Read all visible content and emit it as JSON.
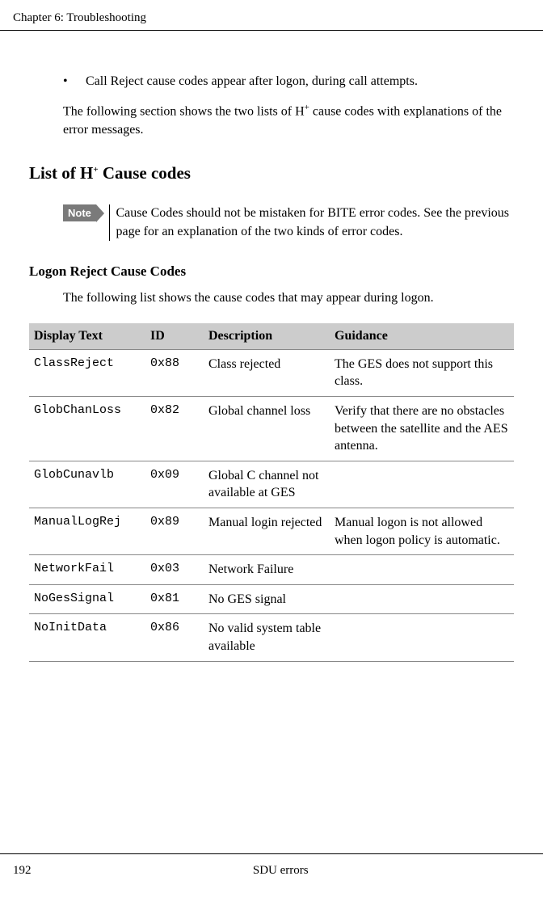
{
  "header": {
    "chapter": "Chapter 6:  Troubleshooting"
  },
  "bullet": {
    "dot": "•",
    "text": "Call Reject cause codes appear after logon, during call attempts."
  },
  "intro": {
    "line1": "The following section shows the two lists of H",
    "sup": "+",
    "line2": " cause codes with explanations of the error messages."
  },
  "section": {
    "title_a": "List of H",
    "title_sup": "+",
    "title_b": " Cause codes"
  },
  "note": {
    "tag": "Note",
    "text": "Cause Codes should not be mistaken for BITE error codes. See the previous page for an explanation of the two kinds of error codes."
  },
  "sub": {
    "heading": "Logon Reject Cause Codes",
    "para": "The following list shows the cause codes that may appear during logon."
  },
  "table": {
    "headers": {
      "display": "Display Text",
      "id": "ID",
      "desc": "Description",
      "guidance": "Guidance"
    },
    "rows": [
      {
        "display": "ClassReject",
        "id": "0x88",
        "desc": "Class rejected",
        "guidance": "The GES does not support this class."
      },
      {
        "display": "GlobChanLoss",
        "id": "0x82",
        "desc": "Global channel loss",
        "guidance": "Verify that there are no obstacles between the satellite and the AES antenna."
      },
      {
        "display": "GlobCunavlb",
        "id": "0x09",
        "desc": "Global C channel not available at GES",
        "guidance": ""
      },
      {
        "display": "ManualLogRej",
        "id": "0x89",
        "desc": "Manual login rejected",
        "guidance": "Manual logon is not allowed when logon policy is automatic."
      },
      {
        "display": "NetworkFail",
        "id": "0x03",
        "desc": "Network Failure",
        "guidance": ""
      },
      {
        "display": "NoGesSignal",
        "id": "0x81",
        "desc": "No GES signal",
        "guidance": ""
      },
      {
        "display": "NoInitData",
        "id": "0x86",
        "desc": "No valid system table available",
        "guidance": ""
      }
    ]
  },
  "footer": {
    "page": "192",
    "title": "SDU errors"
  }
}
